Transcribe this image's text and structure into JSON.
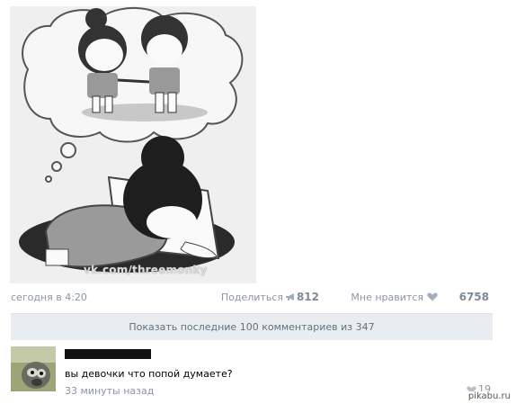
{
  "post": {
    "watermark": "vk.com/threemonky",
    "date": "сегодня в 4:20",
    "share_label": "Поделиться",
    "share_count": "812",
    "like_label": "Мне нравится",
    "like_count": "6758",
    "share_icon": "megaphone-icon",
    "like_icon": "heart-icon"
  },
  "comments_bar": {
    "label": "Показать последние 100 комментариев из 347"
  },
  "comment": {
    "text": "вы девочки что попой думаете?",
    "time": "33 минуты назад",
    "like_count": "19"
  },
  "site_badge": "pikabu.ru",
  "colors": {
    "meta_text": "#8c95a3",
    "bar_bg": "#e9edf1",
    "bar_text": "#61717f"
  }
}
